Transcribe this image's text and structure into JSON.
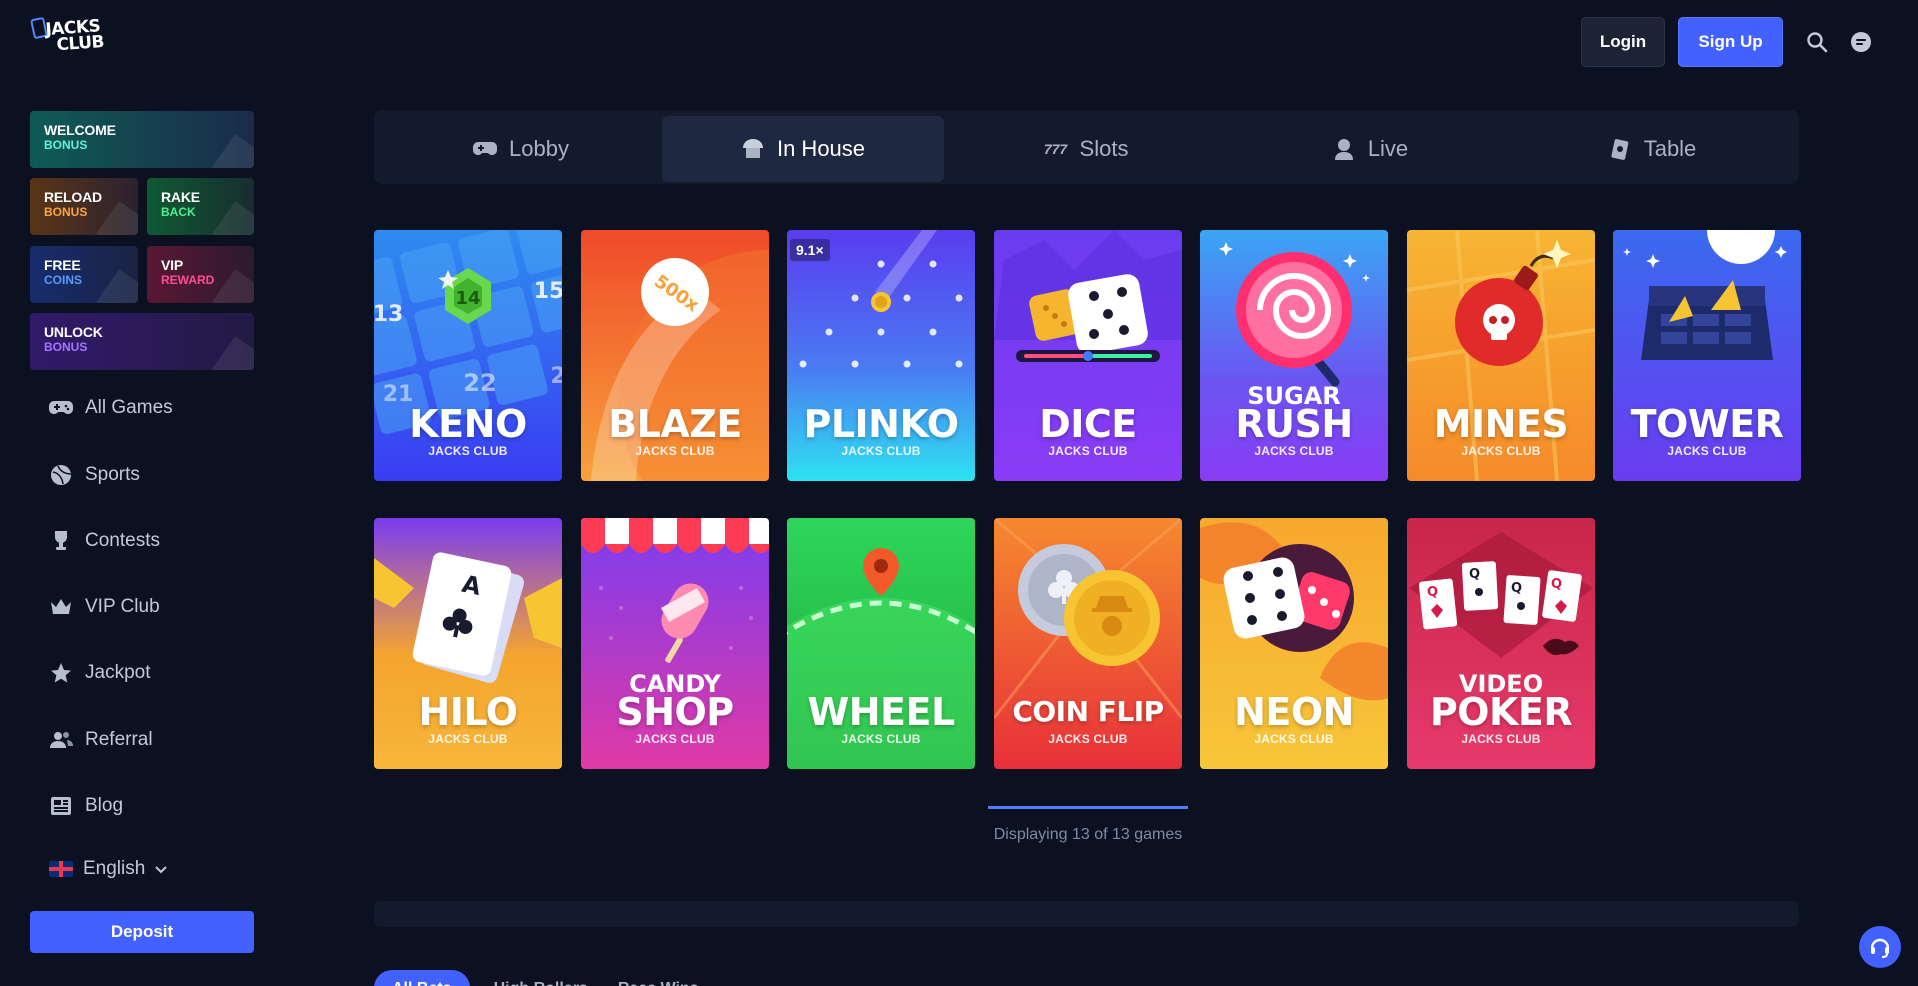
{
  "brand": {
    "line1": "JACKS",
    "line2": "CLUB"
  },
  "header": {
    "login_label": "Login",
    "signup_label": "Sign Up",
    "search_icon": "search-icon",
    "chat_icon": "chat-icon"
  },
  "promos": {
    "welcome": {
      "l1": "WELCOME",
      "l2": "BONUS"
    },
    "reload": {
      "l1": "RELOAD",
      "l2": "BONUS"
    },
    "rake": {
      "l1": "RAKE",
      "l2": "BACK"
    },
    "free": {
      "l1": "FREE",
      "l2": "COINS"
    },
    "vip": {
      "l1": "VIP",
      "l2": "REWARD"
    },
    "unlock": {
      "l1": "UNLOCK",
      "l2": "BONUS"
    }
  },
  "sidebar": {
    "items": [
      {
        "label": "All Games",
        "icon": "gamepad-icon"
      },
      {
        "label": "Sports",
        "icon": "ball-icon"
      },
      {
        "label": "Contests",
        "icon": "trophy-icon"
      },
      {
        "label": "VIP Club",
        "icon": "crown-icon"
      },
      {
        "label": "Jackpot",
        "icon": "star-icon"
      },
      {
        "label": "Referral",
        "icon": "users-icon"
      },
      {
        "label": "Blog",
        "icon": "newspaper-icon"
      }
    ],
    "language": "English",
    "deposit_label": "Deposit"
  },
  "tabs": [
    {
      "label": "Lobby",
      "active": false
    },
    {
      "label": "In House",
      "active": true
    },
    {
      "label": "Slots",
      "active": false
    },
    {
      "label": "Live",
      "active": false
    },
    {
      "label": "Table",
      "active": false
    }
  ],
  "games": [
    {
      "title": "KENO",
      "sub": "JACKS CLUB"
    },
    {
      "title": "BLAZE",
      "sub": "JACKS CLUB",
      "tag": "500x"
    },
    {
      "title": "PLINKO",
      "sub": "JACKS CLUB",
      "badge": "9.1×"
    },
    {
      "title": "DICE",
      "sub": "JACKS CLUB"
    },
    {
      "pre": "SUGAR",
      "title": "RUSH",
      "sub": "JACKS CLUB"
    },
    {
      "title": "MINES",
      "sub": "JACKS CLUB"
    },
    {
      "title": "TOWER",
      "sub": "JACKS CLUB"
    },
    {
      "title": "HILO",
      "sub": "JACKS CLUB"
    },
    {
      "pre": "CANDY",
      "title": "SHOP",
      "sub": "JACKS CLUB"
    },
    {
      "title": "WHEEL",
      "sub": "JACKS CLUB"
    },
    {
      "title": "COIN FLIP",
      "sub": "JACKS CLUB"
    },
    {
      "title": "NEON",
      "sub": "JACKS CLUB"
    },
    {
      "pre": "VIDEO",
      "title": "POKER",
      "sub": "JACKS CLUB"
    }
  ],
  "keno_numbers": [
    "13",
    "14",
    "15",
    "21",
    "22",
    "2"
  ],
  "progress": {
    "text": "Displaying 13 of 13 games",
    "shown": 13,
    "total": 13
  },
  "bets_tabs": [
    "All Bets",
    "High Rollers",
    "Race Wins"
  ],
  "colors": {
    "accent": "#4361ff",
    "background": "#0b1120"
  }
}
